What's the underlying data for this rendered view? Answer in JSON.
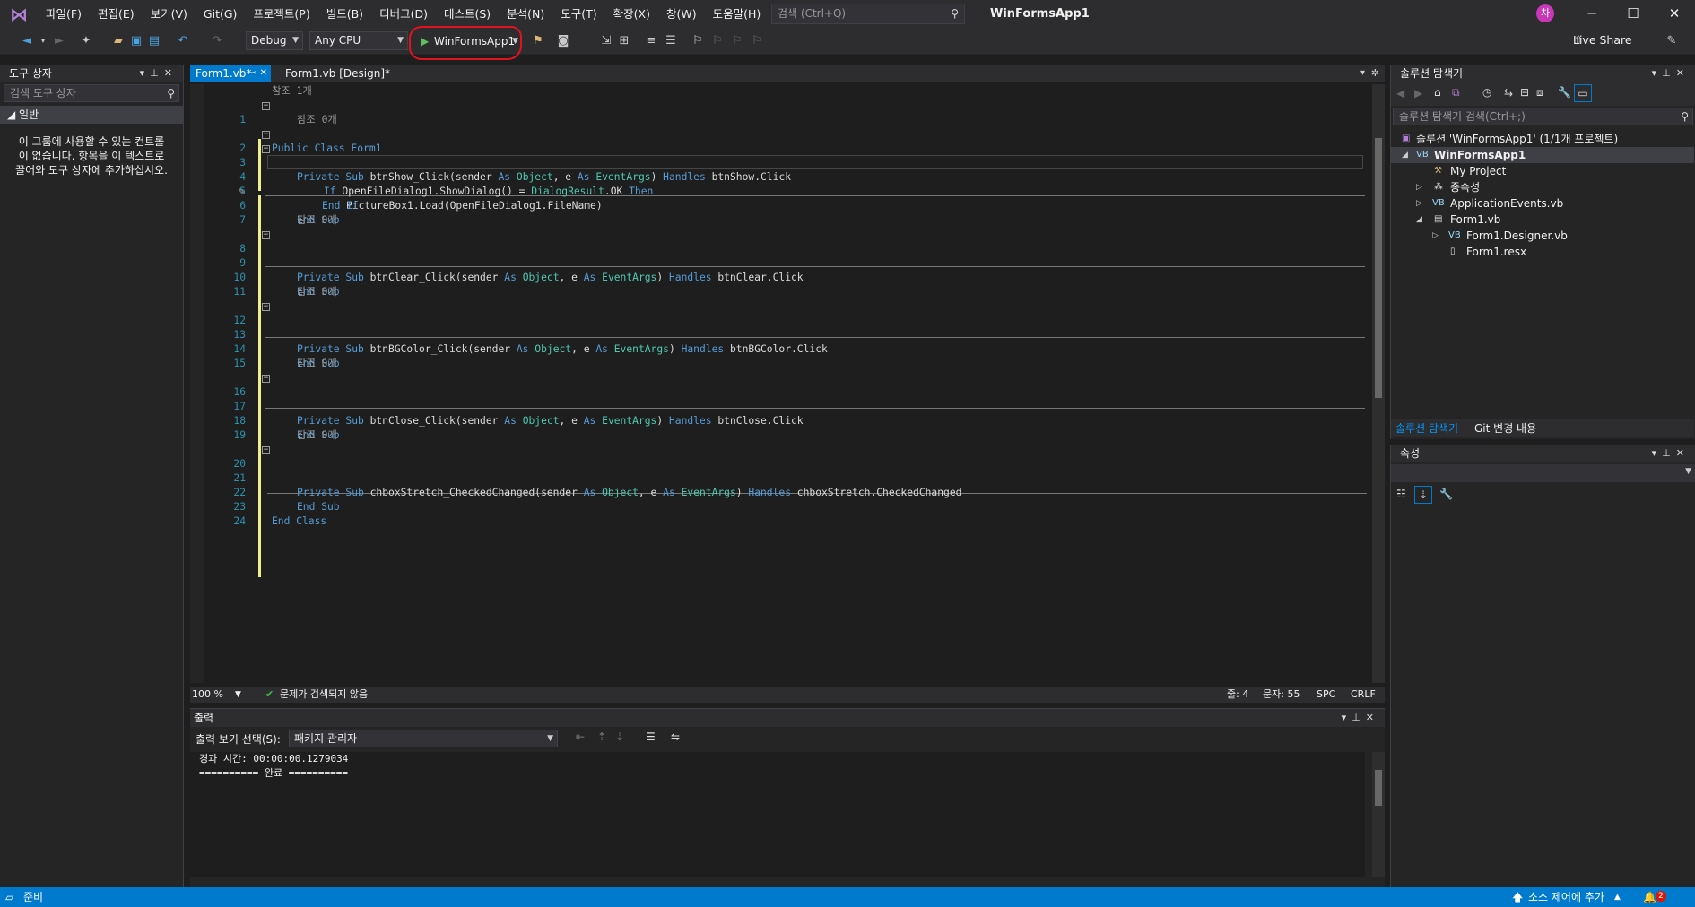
{
  "menu": {
    "items": [
      "파일(F)",
      "편집(E)",
      "보기(V)",
      "Git(G)",
      "프로젝트(P)",
      "빌드(B)",
      "디버그(D)",
      "테스트(S)",
      "분석(N)",
      "도구(T)",
      "확장(X)",
      "창(W)",
      "도움말(H)"
    ],
    "search_placeholder": "검색 (Ctrl+Q)",
    "app_title": "WinFormsApp1",
    "avatar_initial": "차"
  },
  "toolbar": {
    "config": "Debug",
    "platform": "Any CPU",
    "run_target": "WinFormsApp1",
    "live_share": "Live Share"
  },
  "toolbox": {
    "title": "도구 상자",
    "search_placeholder": "검색 도구 상자",
    "group": "일반",
    "empty_message": "이 그룹에 사용할 수 있는 컨트롤이 없습니다. 항목을 이 텍스트로 끌어와 도구 상자에 추가하십시오."
  },
  "tabs": [
    {
      "label": "Form1.vb*",
      "active": true
    },
    {
      "label": "Form1.vb [Design]*",
      "active": false
    }
  ],
  "code": {
    "codelens_1": "참조 1개",
    "codelens_0": "참조 0개",
    "lines": [
      {
        "n": "1",
        "text": "Public Class Form1"
      },
      {
        "n": "2",
        "text": "Private Sub btnShow_Click(sender As Object, e As EventArgs) Handles btnShow.Click"
      },
      {
        "n": "3",
        "text": "If OpenFileDialog1.ShowDialog() = DialogResult.OK Then"
      },
      {
        "n": "4",
        "text": "PictureBox1.Load(OpenFileDialog1.FileName)"
      },
      {
        "n": "5",
        "text": "End If"
      },
      {
        "n": "6",
        "text": "End Sub"
      },
      {
        "n": "7",
        "text": ""
      },
      {
        "n": "8",
        "text": "Private Sub btnClear_Click(sender As Object, e As EventArgs) Handles btnClear.Click"
      },
      {
        "n": "9",
        "text": ""
      },
      {
        "n": "10",
        "text": "End Sub"
      },
      {
        "n": "11",
        "text": ""
      },
      {
        "n": "12",
        "text": "Private Sub btnBGColor_Click(sender As Object, e As EventArgs) Handles btnBGColor.Click"
      },
      {
        "n": "13",
        "text": ""
      },
      {
        "n": "14",
        "text": "End Sub"
      },
      {
        "n": "15",
        "text": ""
      },
      {
        "n": "16",
        "text": "Private Sub btnClose_Click(sender As Object, e As EventArgs) Handles btnClose.Click"
      },
      {
        "n": "17",
        "text": ""
      },
      {
        "n": "18",
        "text": "End Sub"
      },
      {
        "n": "19",
        "text": ""
      },
      {
        "n": "20",
        "text": "Private Sub chboxStretch_CheckedChanged(sender As Object, e As EventArgs) Handles chboxStretch.CheckedChanged"
      },
      {
        "n": "21",
        "text": ""
      },
      {
        "n": "22",
        "text": "End Sub"
      },
      {
        "n": "23",
        "text": "End Class"
      },
      {
        "n": "24",
        "text": ""
      }
    ]
  },
  "editor_status": {
    "zoom": "100 %",
    "issues": "문제가 검색되지 않음",
    "line": "줄: 4",
    "col": "문자: 55",
    "spc": "SPC",
    "crlf": "CRLF"
  },
  "output": {
    "title": "출력",
    "source_label": "출력 보기 선택(S):",
    "source_value": "패키지 관리자",
    "text": "경과 시간: 00:00:00.1279034\n========== 완료 =========="
  },
  "solution_explorer": {
    "title": "솔루션 탐색기",
    "search_placeholder": "솔루션 탐색기 검색(Ctrl+;)",
    "solution": "솔루션 'WinFormsApp1' (1/1개 프로젝트)",
    "project": "WinFormsApp1",
    "items": [
      "My Project",
      "종속성",
      "ApplicationEvents.vb",
      "Form1.vb",
      "Form1.Designer.vb",
      "Form1.resx"
    ],
    "tab_solution": "솔루션 탐색기",
    "tab_git": "Git 변경 내용"
  },
  "properties": {
    "title": "속성"
  },
  "statusbar": {
    "ready": "준비",
    "source_control": "소스 제어에 추가",
    "notifications": "2"
  },
  "colors": {
    "accent": "#007acc",
    "keyword": "#569cd6",
    "type": "#4ec9b0",
    "highlight": "#e0141e"
  }
}
